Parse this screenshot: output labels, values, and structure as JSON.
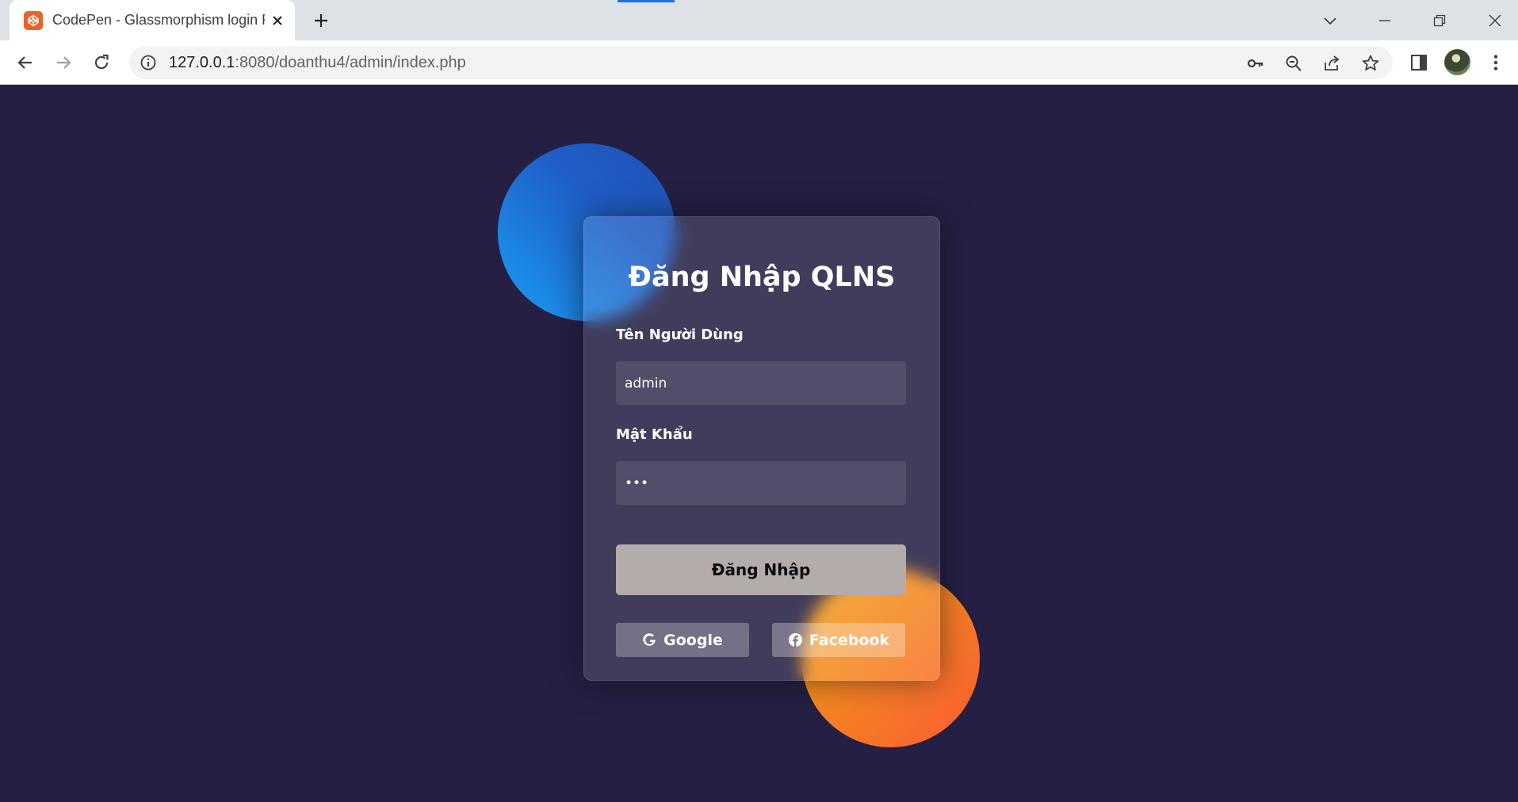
{
  "browser": {
    "tab_title": "CodePen - Glassmorphism login Form",
    "url_host": "127.0.0.1",
    "url_rest": ":8080/doanthu4/admin/index.php"
  },
  "icons": {
    "favicon": "codepen-favicon-icon",
    "tab_close": "close-icon",
    "new_tab": "plus-icon",
    "back": "back-arrow-icon",
    "forward": "forward-arrow-icon",
    "reload": "reload-icon",
    "site_info": "info-icon",
    "password_key": "key-icon",
    "zoom": "zoom-out-icon",
    "share": "share-icon",
    "bookmark": "star-icon",
    "side_panel": "side-panel-icon",
    "menu": "kebab-menu-icon",
    "google": "google-g-icon",
    "facebook": "facebook-icon"
  },
  "login": {
    "title": "Đăng Nhập QLNS",
    "username_label": "Tên Người Dùng",
    "username_value": "admin",
    "password_label": "Mật Khẩu",
    "password_value": "abc",
    "submit_label": "Đăng Nhập",
    "google_label": "Google",
    "facebook_label": "Facebook"
  },
  "colors": {
    "page_background": "#252043",
    "blue_circle": "#1f5fc7",
    "orange_circle": "#f38b1f",
    "submit_button": "#b3acab"
  }
}
